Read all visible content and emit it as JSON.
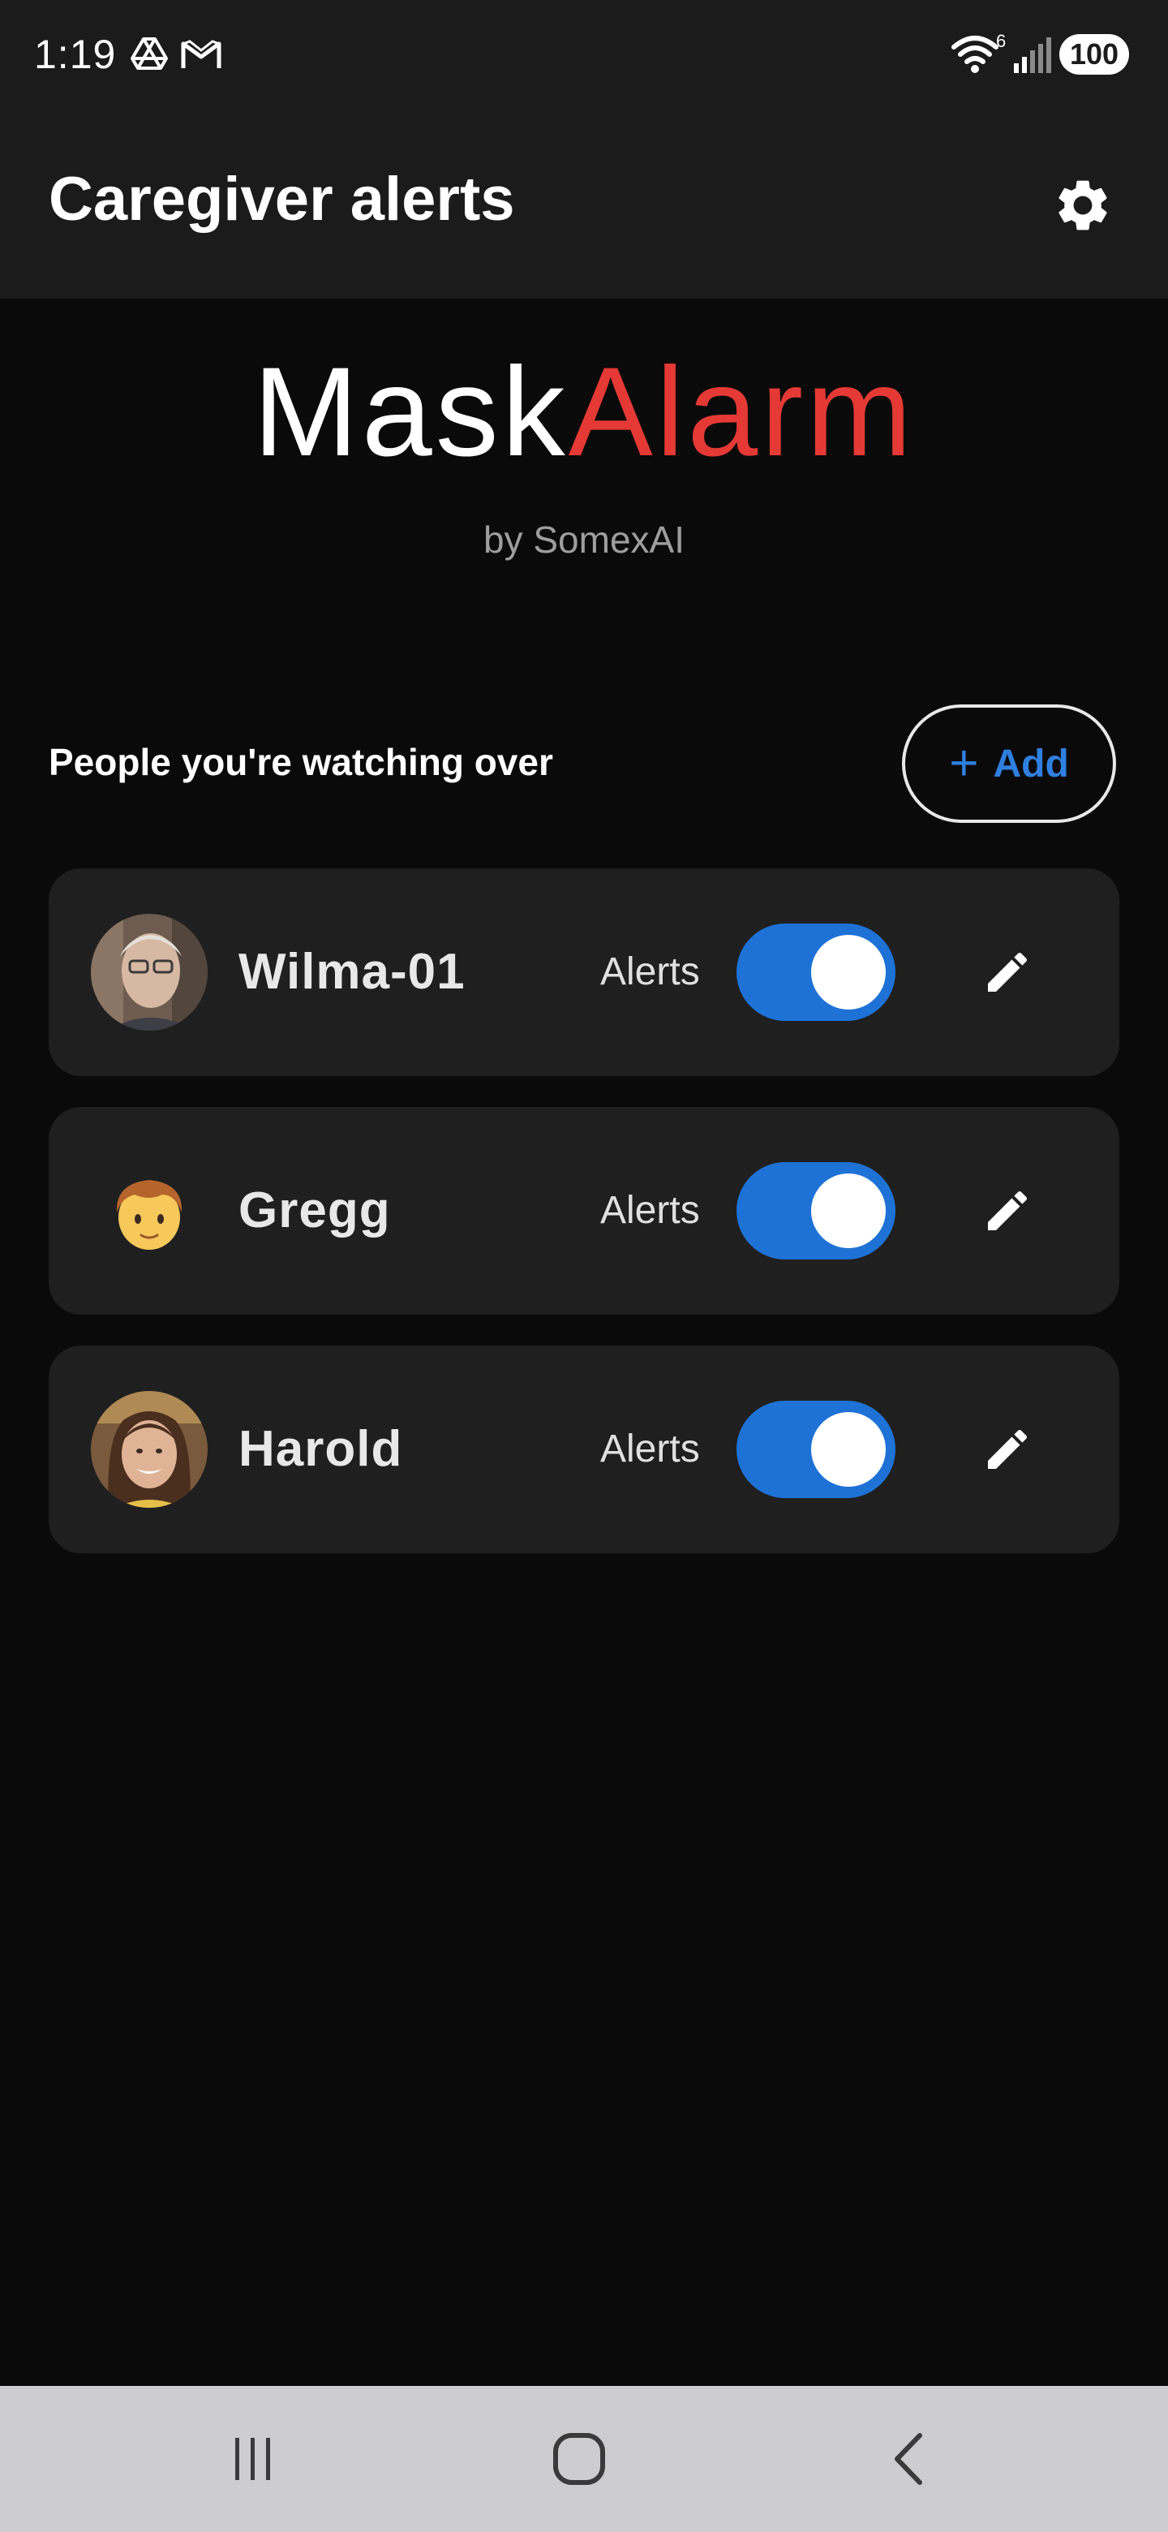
{
  "status_bar": {
    "time": "1:19",
    "notification_icons": [
      "drive-icon",
      "gmail-icon"
    ],
    "wifi_badge": "6",
    "battery": "100"
  },
  "app_bar": {
    "title": "Caregiver alerts",
    "settings_icon": "gear-icon"
  },
  "logo": {
    "word1": "Mask",
    "word2": "Alarm",
    "byline": "by SomexAI",
    "accent_color": "#e53935"
  },
  "section": {
    "title": "People you're watching over",
    "add_label": "Add",
    "add_color": "#2f7fe0"
  },
  "people": [
    {
      "name": "Wilma-01",
      "avatar": "photo-avatar",
      "alerts_label": "Alerts",
      "alerts_on": true
    },
    {
      "name": "Gregg",
      "avatar": "child-emoji-avatar",
      "alerts_label": "Alerts",
      "alerts_on": true
    },
    {
      "name": "Harold",
      "avatar": "photo-avatar",
      "alerts_label": "Alerts",
      "alerts_on": true
    }
  ],
  "toggle_color": "#1e72d6",
  "nav_bar": {
    "icons": [
      "recent-apps-icon",
      "home-icon",
      "back-icon"
    ]
  }
}
